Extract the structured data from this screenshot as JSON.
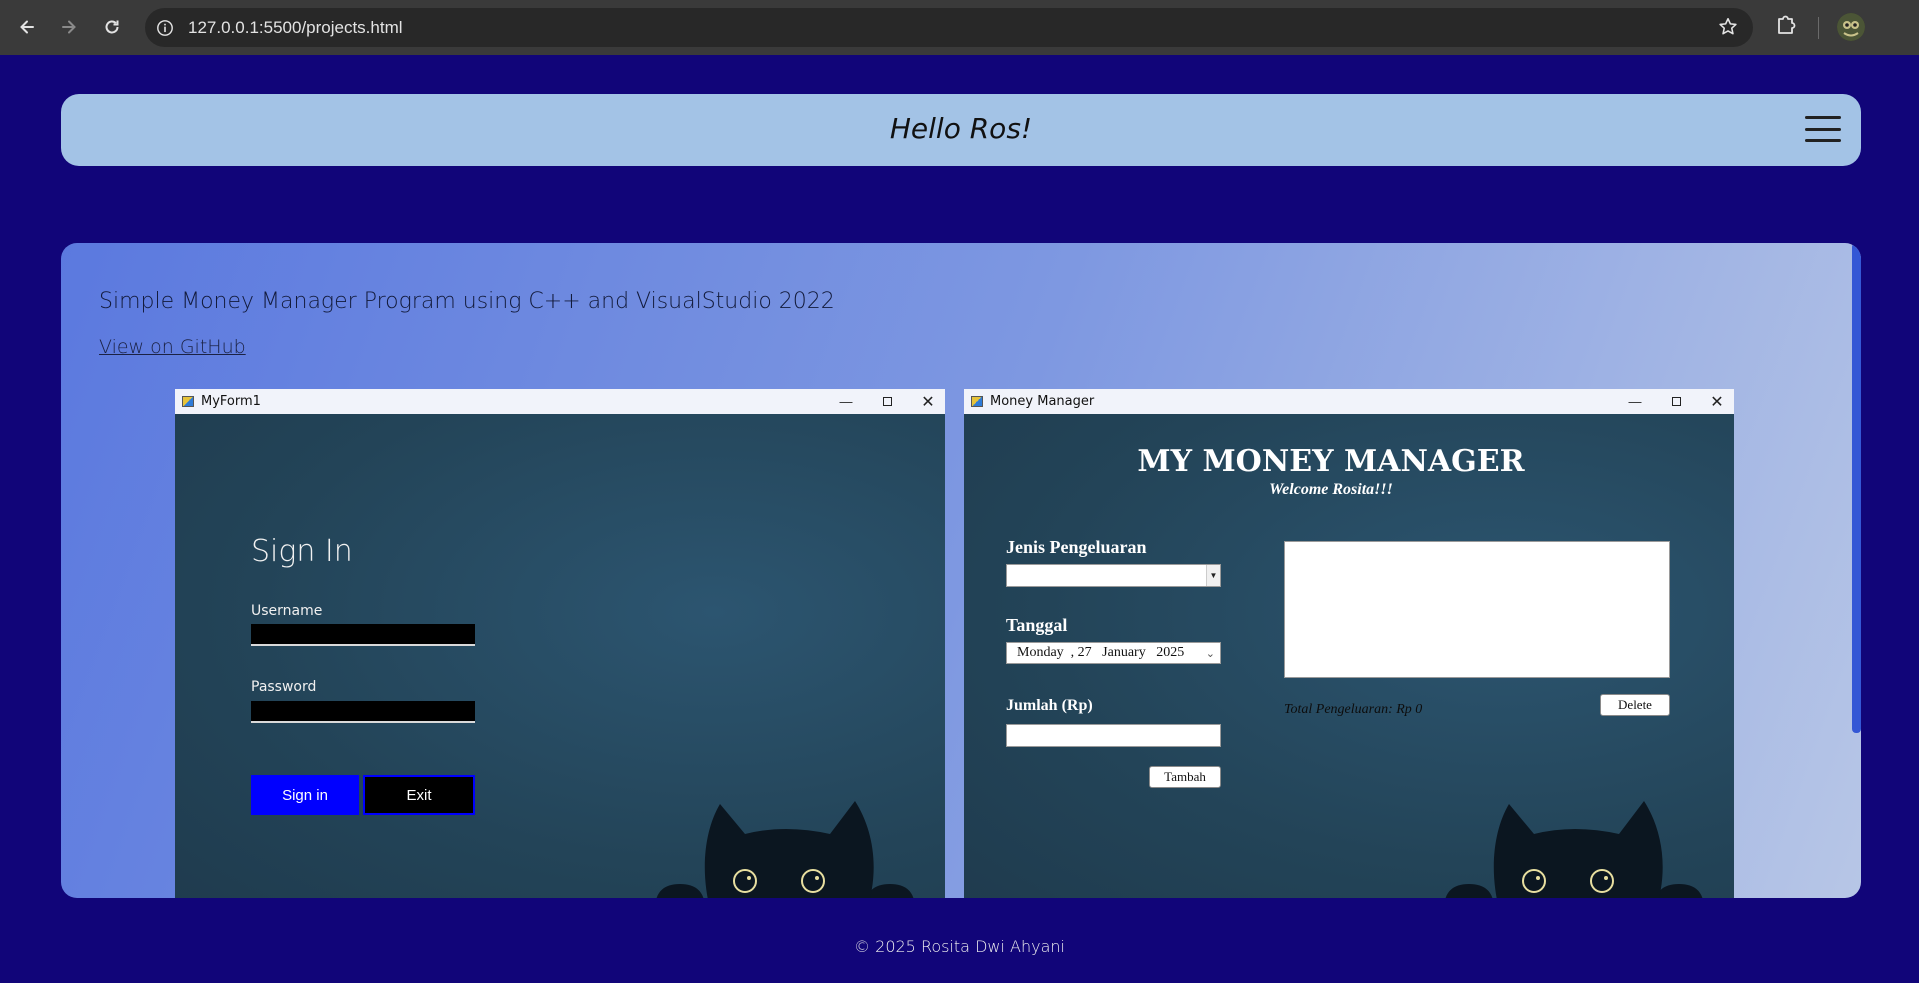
{
  "browser": {
    "url": "127.0.0.1:5500/projects.html"
  },
  "header": {
    "title": "Hello Ros!"
  },
  "project": {
    "title": "Simple Money Manager Program using C++ and VisualStudio 2022",
    "link_label": "View on GitHub"
  },
  "signin_window": {
    "window_title": "MyForm1",
    "heading": "Sign In",
    "username_label": "Username",
    "password_label": "Password",
    "signin_button": "Sign in",
    "exit_button": "Exit"
  },
  "money_window": {
    "window_title": "Money Manager",
    "heading": "MY MONEY MANAGER",
    "welcome": "Welcome Rosita!!!",
    "expense_type_label": "Jenis Pengeluaran",
    "date_label": "Tanggal",
    "date_value": "Monday  , 27   January   2025",
    "amount_label": "Jumlah (Rp)",
    "add_button": "Tambah",
    "delete_button": "Delete",
    "total_text": "Total Pengeluaran: Rp 0"
  },
  "footer": {
    "text": "© 2025 Rosita Dwi Ahyani"
  },
  "colors": {
    "page_bg": "#110579",
    "header_bg": "#a3c3e6",
    "signin_button": "#0000ff"
  }
}
